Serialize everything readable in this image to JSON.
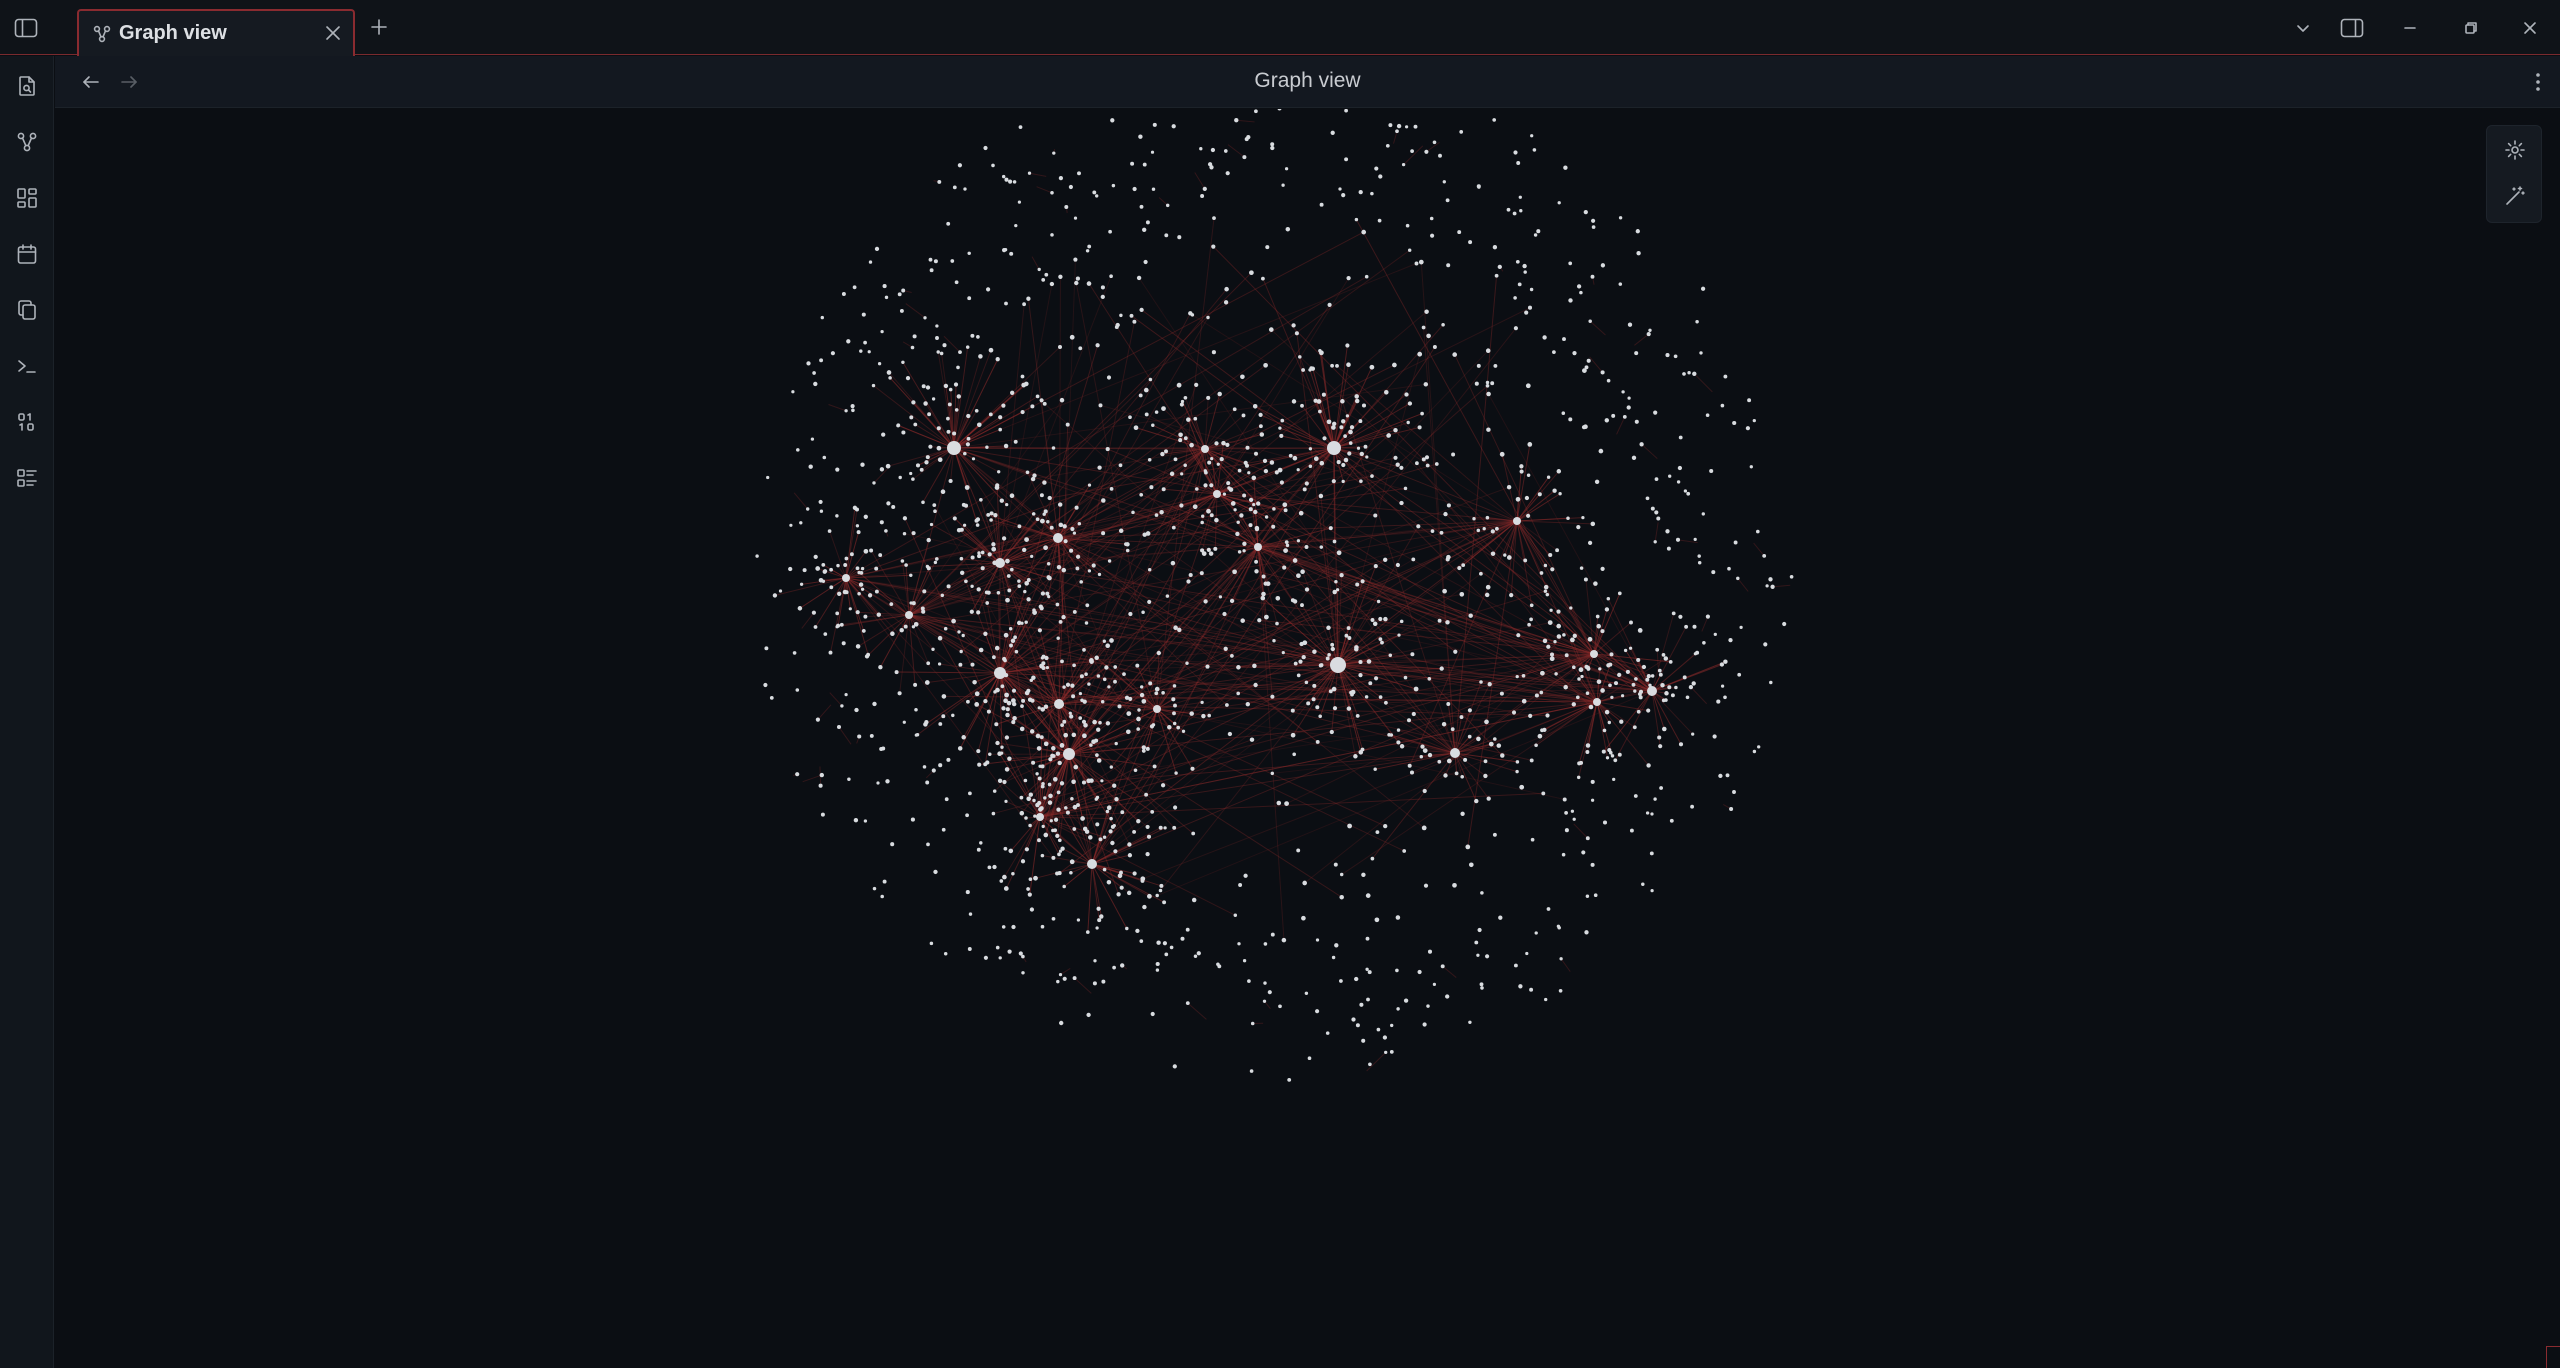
{
  "tab": {
    "title": "Graph view",
    "icon": "graph-icon"
  },
  "view": {
    "title": "Graph view"
  },
  "ribbon": [
    {
      "name": "search-file-icon"
    },
    {
      "name": "graph-icon"
    },
    {
      "name": "canvas-icon"
    },
    {
      "name": "calendar-icon"
    },
    {
      "name": "copy-icon"
    },
    {
      "name": "terminal-icon"
    },
    {
      "name": "binary-icon"
    },
    {
      "name": "list-checks-icon"
    }
  ],
  "colors": {
    "background": "#0b0e13",
    "accent": "#8a2b30",
    "node": "#d9dce0",
    "edge": "#8c2a2a"
  },
  "graph": {
    "node_count": 1300,
    "hubs": 16
  }
}
